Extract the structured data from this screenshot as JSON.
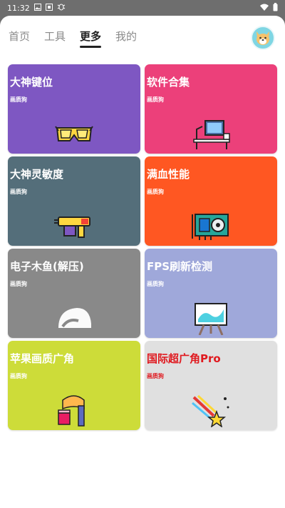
{
  "statusbar": {
    "time": "11:32",
    "icons_left": [
      "image-icon",
      "sim-icon",
      "bug-icon"
    ],
    "icons_right": [
      "wifi-icon",
      "battery-icon"
    ]
  },
  "tabs": [
    {
      "label": "首页",
      "active": false
    },
    {
      "label": "工具",
      "active": false
    },
    {
      "label": "更多",
      "active": true
    },
    {
      "label": "我的",
      "active": false
    }
  ],
  "cards": [
    {
      "title": "大神键位",
      "sub": "画质狗",
      "color": "#7e57c2",
      "icon": "goggles-icon"
    },
    {
      "title": "软件合集",
      "sub": "画质狗",
      "color": "#ec407a",
      "icon": "desk-computer-icon"
    },
    {
      "title": "大神灵敏度",
      "sub": "画质狗",
      "color": "#546e7a",
      "icon": "blaster-gun-icon"
    },
    {
      "title": "满血性能",
      "sub": "画质狗",
      "color": "#ff5722",
      "icon": "graphics-card-icon"
    },
    {
      "title": "电子木鱼(解压)",
      "sub": "画质狗",
      "color": "#898989",
      "icon": "wooden-fish-icon"
    },
    {
      "title": "FPS刷新检测",
      "sub": "画质狗",
      "color": "#9fa8da",
      "icon": "easel-icon"
    },
    {
      "title": "苹果画质广角",
      "sub": "画质狗",
      "color": "#cddc39",
      "icon": "paint-brush-icon"
    },
    {
      "title": "国际超广角Pro",
      "sub": "画质狗",
      "color": "#e0e0e0",
      "icon": "shooting-star-icon",
      "text_color": "#e0191f"
    }
  ]
}
